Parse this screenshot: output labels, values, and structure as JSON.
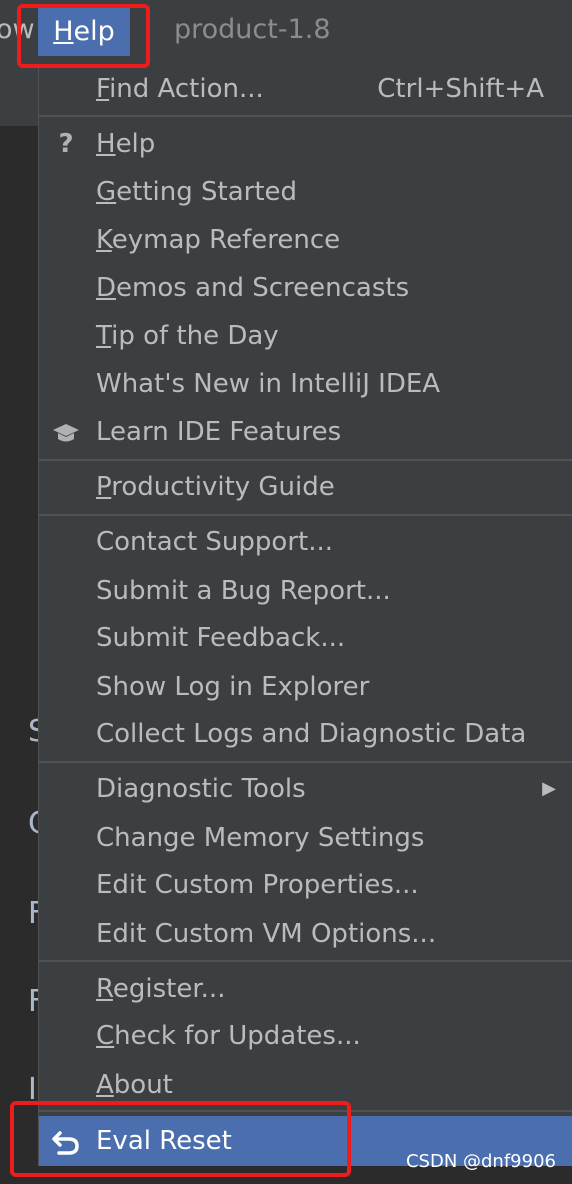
{
  "menubar": {
    "prev_menu_fragment": "ow",
    "help_label": "Help",
    "project_title": "product-1.8"
  },
  "editor_peek": [
    "S",
    "C",
    "F",
    "F",
    "I"
  ],
  "menu": {
    "find_action": {
      "label": "Find Action...",
      "shortcut": "Ctrl+Shift+A"
    },
    "group1": [
      {
        "label": "Help",
        "icon": "question-mark-icon"
      },
      {
        "label": "Getting Started"
      },
      {
        "label": "Keymap Reference"
      },
      {
        "label": "Demos and Screencasts"
      },
      {
        "label": "Tip of the Day"
      },
      {
        "label": "What's New in IntelliJ IDEA"
      },
      {
        "label": "Learn IDE Features",
        "icon": "graduation-cap-icon"
      }
    ],
    "group2": [
      {
        "label": "Productivity Guide"
      }
    ],
    "group3": [
      {
        "label": "Contact Support..."
      },
      {
        "label": "Submit a Bug Report..."
      },
      {
        "label": "Submit Feedback..."
      },
      {
        "label": "Show Log in Explorer"
      },
      {
        "label": "Collect Logs and Diagnostic Data"
      }
    ],
    "group4": [
      {
        "label": "Diagnostic Tools",
        "has_submenu": true
      },
      {
        "label": "Change Memory Settings"
      },
      {
        "label": "Edit Custom Properties..."
      },
      {
        "label": "Edit Custom VM Options..."
      }
    ],
    "group5": [
      {
        "label": "Register..."
      },
      {
        "label": "Check for Updates..."
      },
      {
        "label": "About"
      }
    ],
    "eval_reset": {
      "label": "Eval Reset",
      "icon": "undo-arrow-icon"
    }
  },
  "watermark": "CSDN @dnf9906",
  "colors": {
    "menu_bg": "#3c3f41",
    "selection": "#4b6eaf",
    "annotation_red": "#ee1c1c",
    "text": "#bbbbbb"
  }
}
